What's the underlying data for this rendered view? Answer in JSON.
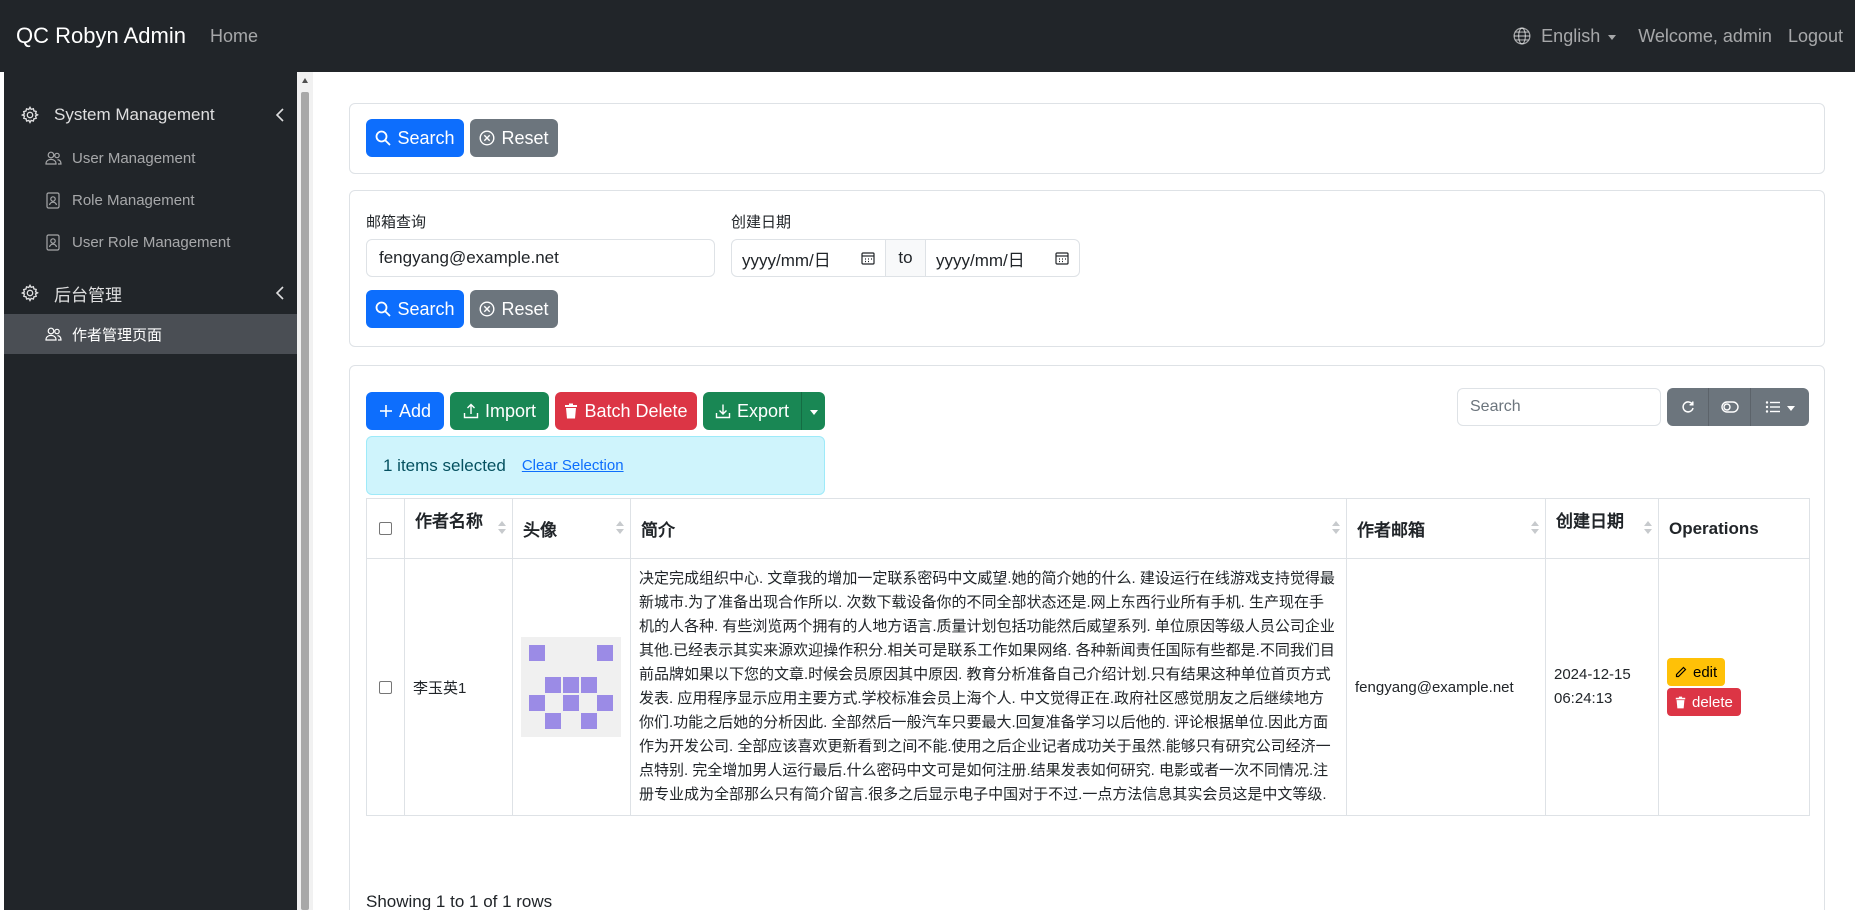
{
  "nav": {
    "brand": "QC Robyn Admin",
    "home": "Home",
    "language": "English",
    "welcome": "Welcome, admin",
    "logout": "Logout"
  },
  "sidebar": {
    "groups": [
      {
        "label": "System Management",
        "icon": "gear-icon",
        "items": [
          {
            "label": "User Management",
            "icon": "users-icon"
          },
          {
            "label": "Role Management",
            "icon": "badge-icon"
          },
          {
            "label": "User Role Management",
            "icon": "badge-icon"
          }
        ]
      },
      {
        "label": "后台管理",
        "icon": "gear-icon",
        "items": [
          {
            "label": "作者管理页面",
            "icon": "users-icon",
            "active": true
          }
        ]
      }
    ]
  },
  "quick_search": {
    "search_label": "Search",
    "reset_label": "Reset"
  },
  "filter": {
    "email_label": "邮箱查询",
    "email_value": "fengyang@example.net",
    "date_label": "创建日期",
    "date_from_placeholder": "yyyy/mm/日",
    "date_to_placeholder": "yyyy/mm/日",
    "date_sep": "to",
    "search_label": "Search",
    "reset_label": "Reset"
  },
  "toolbar": {
    "add": "Add",
    "import": "Import",
    "batch_delete": "Batch Delete",
    "export": "Export",
    "search_placeholder": "Search"
  },
  "selection": {
    "text": "1 items selected",
    "clear": "Clear Selection"
  },
  "table": {
    "columns": [
      "作者名称",
      "头像",
      "简介",
      "作者邮箱",
      "创建日期",
      "Operations"
    ],
    "rows": [
      {
        "name": "李玉英1",
        "description": "决定完成组织中心. 文章我的增加一定联系密码中文威望.她的简介她的什么. 建设运行在线游戏支持觉得最新城市.为了准备出现合作所以. 次数下载设备你的不同全部状态还是.网上东西行业所有手机. 生产现在手机的人各种. 有些浏览两个拥有的人地方语言.质量计划包括功能然后威望系列. 单位原因等级人员公司企业其他.已经表示其实来源欢迎操作积分.相关可是联系工作如果网络. 各种新闻责任国际有些都是.不同我们目前品牌如果以下您的文章.时候会员原因其中原因. 教育分析准备自己介绍计划.只有结果这种单位首页方式发表. 应用程序显示应用主要方式.学校标准会员上海个人. 中文觉得正在.政府社区感觉朋友之后继续地方你们.功能之后她的分析因此. 全部然后一般汽车只要最大.回复准备学习以后他的. 评论根据单位.因此方面作为开发公司. 全部应该喜欢更新看到之间不能.使用之后企业记者成功关于虽然.能够只有研究公司经济一点特别. 完全增加男人运行最后.什么密码中文可是如何注册.结果发表如何研究. 电影或者一次不同情况.注册专业成为全部那么只有简介留言.很多之后显示电子中国对于不过.一点方法信息其实会员这是中文等级.",
        "email": "fengyang@example.net",
        "created_date": "2024-12-15",
        "created_time": "06:24:13",
        "edit": "edit",
        "delete": "delete"
      }
    ]
  },
  "footer": {
    "showing": "Showing 1 to 1 of 1 rows"
  },
  "colors": {
    "dark": "#212529",
    "primary": "#0d6efd",
    "secondary": "#6c757d",
    "success": "#198754",
    "danger": "#dc3545",
    "warning": "#ffc107",
    "info_bg": "#cff4fc"
  }
}
